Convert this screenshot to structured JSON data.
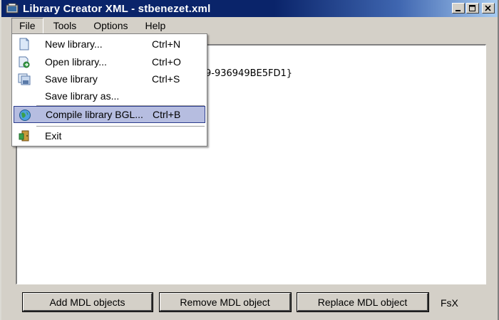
{
  "window": {
    "title": "Library Creator XML - stbenezet.xml",
    "icon": "library-creator-app-icon",
    "controls": [
      "minimize",
      "maximize",
      "close"
    ]
  },
  "menubar": {
    "items": [
      {
        "label": "File",
        "active": true
      },
      {
        "label": "Tools",
        "active": false
      },
      {
        "label": "Options",
        "active": false
      },
      {
        "label": "Help",
        "active": false
      }
    ]
  },
  "content": {
    "guid_fragment": "9-936949BE5FD1}"
  },
  "file_menu": {
    "items": [
      {
        "label": "New library...",
        "shortcut": "Ctrl+N",
        "icon": "new-document-icon"
      },
      {
        "label": "Open library...",
        "shortcut": "Ctrl+O",
        "icon": "open-library-icon"
      },
      {
        "label": "Save library",
        "shortcut": "Ctrl+S",
        "icon": "save-library-icon"
      },
      {
        "label": "Save library as...",
        "shortcut": "",
        "icon": ""
      },
      {
        "label": "Compile library BGL...",
        "shortcut": "Ctrl+B",
        "icon": "compile-globe-icon",
        "highlighted": true
      },
      {
        "label": "Exit",
        "shortcut": "",
        "icon": "exit-door-icon"
      }
    ]
  },
  "buttons": {
    "add": "Add MDL objects",
    "remove": "Remove MDL object",
    "replace": "Replace MDL object"
  },
  "status": {
    "sim_label": "FsX"
  },
  "colors": {
    "titlebar_start": "#0a246a",
    "titlebar_end": "#a6caf0",
    "menu_highlight": "#b6bde0",
    "chrome": "#d4d0c8"
  }
}
